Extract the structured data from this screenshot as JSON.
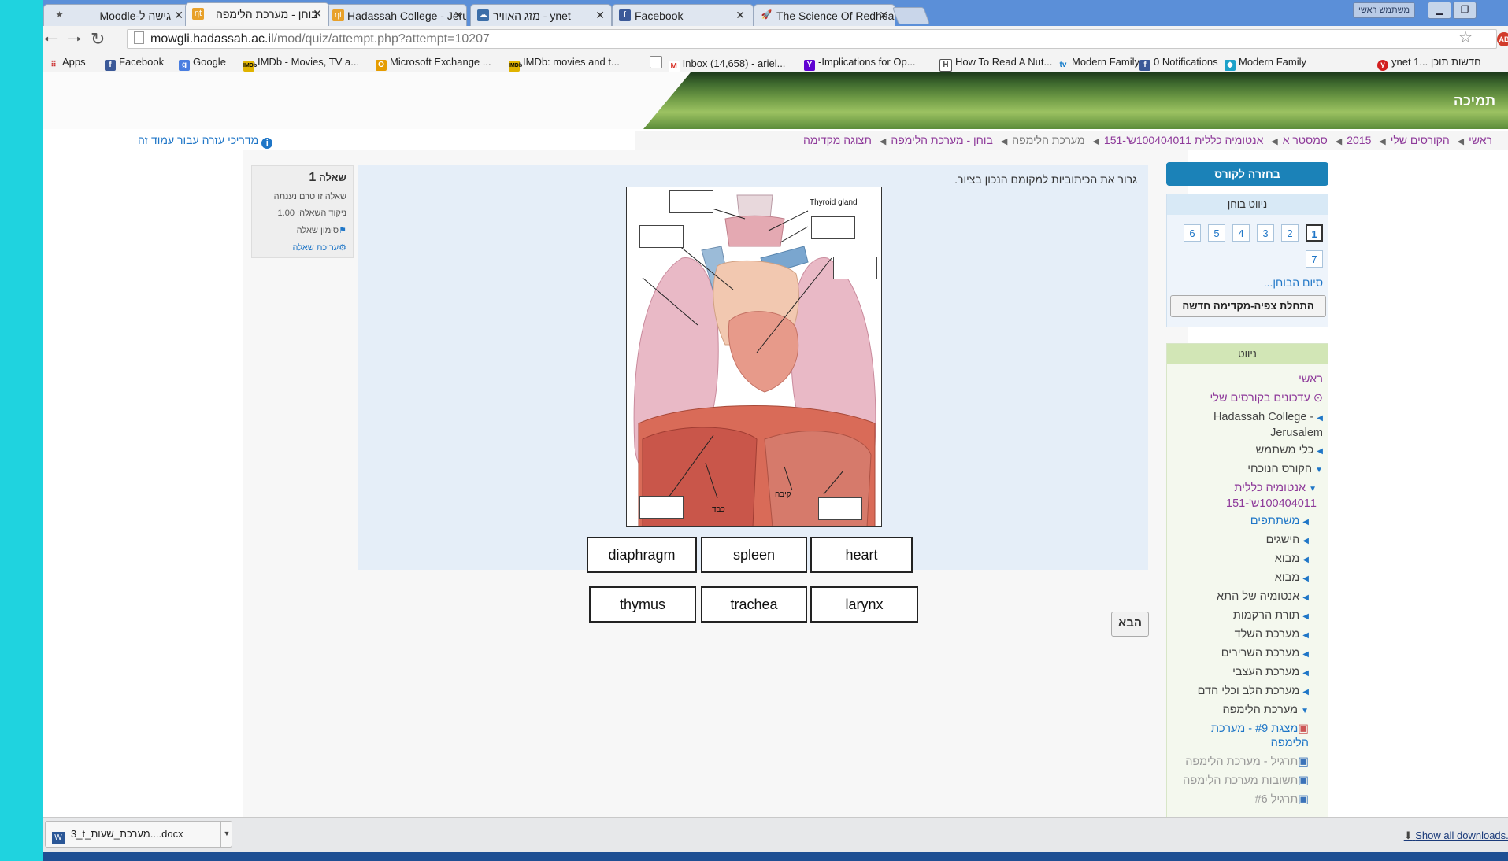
{
  "tabs": [
    {
      "title": "גישה ל-Moodle"
    },
    {
      "title": "בוחן - מערכת הלימפה"
    },
    {
      "title": "Hadassah College - Jerusa"
    },
    {
      "title": "מזג האוויר - ynet"
    },
    {
      "title": "Facebook"
    },
    {
      "title": "The Science Of Redheads"
    }
  ],
  "window_caption": "משתמש ראשי",
  "url": {
    "host": "mowgli.hadassah.ac.il",
    "path": "/mod/quiz/attempt.php?attempt=10207"
  },
  "bookmarks": [
    "Apps",
    "Facebook",
    "Google",
    "IMDb - Movies, TV a...",
    "Microsoft Exchange ...",
    "IMDb: movies and t...",
    "Inbox (14,658) - ariel...",
    "-Implications for Op...",
    "How To Read A Nut...",
    "Modern Family",
    "0 Notifications",
    "Modern Family",
    "ynet 1... חדשות תוכן"
  ],
  "header": {
    "support": "תמיכה"
  },
  "breadcrumbs": [
    "ראשי",
    "הקורסים שלי",
    "2015",
    "סמסטר א",
    "אנטומיה כללית 100404011ש'-151",
    "מערכת הלימפה",
    "בוחן - מערכת הלימפה",
    "תצוגה מקדימה"
  ],
  "help_link": "מדריכי עזרה עבור עמוד זה",
  "question_info": {
    "label": "שאלה",
    "number": "1",
    "status": "שאלה זו טרם נענתה",
    "points": "ניקוד השאלה: 1.00",
    "flag": "סימון שאלה",
    "edit": "עריכת שאלה"
  },
  "question": {
    "prompt": "גרור את הכיתוביות למקומם הנכון בציור.",
    "diagram_labels": {
      "thyroid": "Thyroid gland",
      "liver": "כבד",
      "stomach": "קיבה"
    },
    "chips_row1": [
      "diaphragm",
      "spleen",
      "heart"
    ],
    "chips_row2": [
      "thymus",
      "trachea",
      "larynx"
    ]
  },
  "next_button": "הבא",
  "return_button": "בחזרה לקורס",
  "quiz_nav": {
    "title": "ניווט בוחן",
    "numbers": [
      "1",
      "2",
      "3",
      "4",
      "5",
      "6",
      "7"
    ],
    "current": "1",
    "finish": "סיום הבוחן...",
    "preview": "התחלת צפיה-מקדימה חדשה"
  },
  "navigation": {
    "title": "ניווט",
    "items": [
      "ראשי",
      "עדכונים בקורסים שלי",
      "Hadassah College - Jerusalem",
      "כלי משתמש",
      "הקורס הנוכחי",
      "אנטומיה כללית 100404011ש'-151",
      "משתתפים",
      "הישגים",
      "מבוא",
      "מבוא",
      "אנטומיה של התא",
      "תורת הרקמות",
      "מערכת השלד",
      "מערכת השרירים",
      "מערכת העצבי",
      "מערכת הלב וכלי הדם",
      "מערכת הלימפה",
      "מצגת #9 - מערכת הלימפה",
      "תרגיל - מערכת הלימפה",
      "תשובות מערכת הלימפה",
      "תרגיל #6"
    ]
  },
  "downloads": {
    "file": "3_t_מערכת_שעות....docx",
    "show_all": "Show all downloads..."
  }
}
